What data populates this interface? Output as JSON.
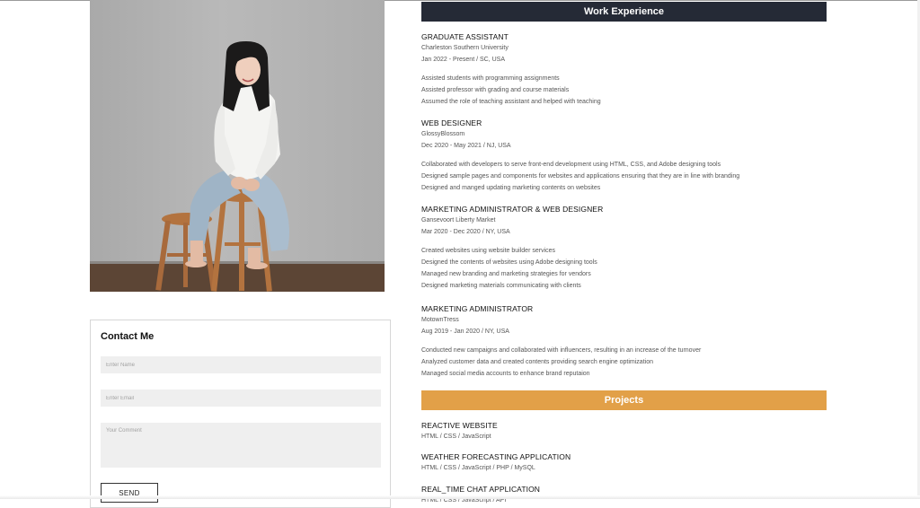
{
  "work_experience": {
    "heading": "Work Experience",
    "jobs": [
      {
        "title": "GRADUATE ASSISTANT",
        "company": "Charleston Southern University",
        "period": "Jan 2022 - Present / SC, USA",
        "duties": [
          "Assisted students with programming assignments",
          "Assisted professor with grading and course materials",
          "Assumed the role of teaching assistant and helped with teaching"
        ]
      },
      {
        "title": "WEB DESIGNER",
        "company": "GlossyBlossom",
        "period": "Dec 2020 - May 2021 / NJ, USA",
        "duties": [
          "Collaborated with developers to serve front-end development using HTML, CSS, and Adobe designing tools",
          "Designed sample pages and components for websites and applications ensuring that they are in line with branding",
          "Designed and manged updating marketing contents on websites"
        ]
      },
      {
        "title": "MARKETING ADMINISTRATOR & WEB DESIGNER",
        "company": "Gansevoort Liberty Market",
        "period": "Mar 2020 - Dec 2020 / NY, USA",
        "duties": [
          "Created websites using website builder services",
          "Designed the contents of websites using Adobe designing tools",
          "Managed new branding and marketing strategies for vendors",
          "Designed marketing materials communicating with clients"
        ]
      },
      {
        "title": "MARKETING ADMINISTRATOR",
        "company": "MotownTress",
        "period": "Aug 2019 - Jan 2020 / NY, USA",
        "duties": [
          "Conducted new campaigns and collaborated with influencers, resulting in an increase of the turnover",
          "Analyzed customer data and created contents providing search engine optimization",
          "Managed social media accounts to enhance brand reputaion"
        ]
      }
    ]
  },
  "projects": {
    "heading": "Projects",
    "items": [
      {
        "title": "REACTIVE WEBSITE",
        "tech": "HTML / CSS / JavaScript"
      },
      {
        "title": "WEATHER FORECASTING APPLICATION",
        "tech": "HTML / CSS / JavaScript / PHP / MySQL"
      },
      {
        "title": "REAL_TIME CHAT APPLICATION",
        "tech": "HTML / CSS / JavaScript / API"
      }
    ]
  },
  "contact": {
    "heading": "Contact Me",
    "name_placeholder": "Enter Name",
    "email_placeholder": "Enter Email",
    "comment_placeholder": "Your Comment",
    "send_label": "SEND"
  },
  "colors": {
    "work_bar": "#252a36",
    "projects_bar": "#e2a048"
  }
}
